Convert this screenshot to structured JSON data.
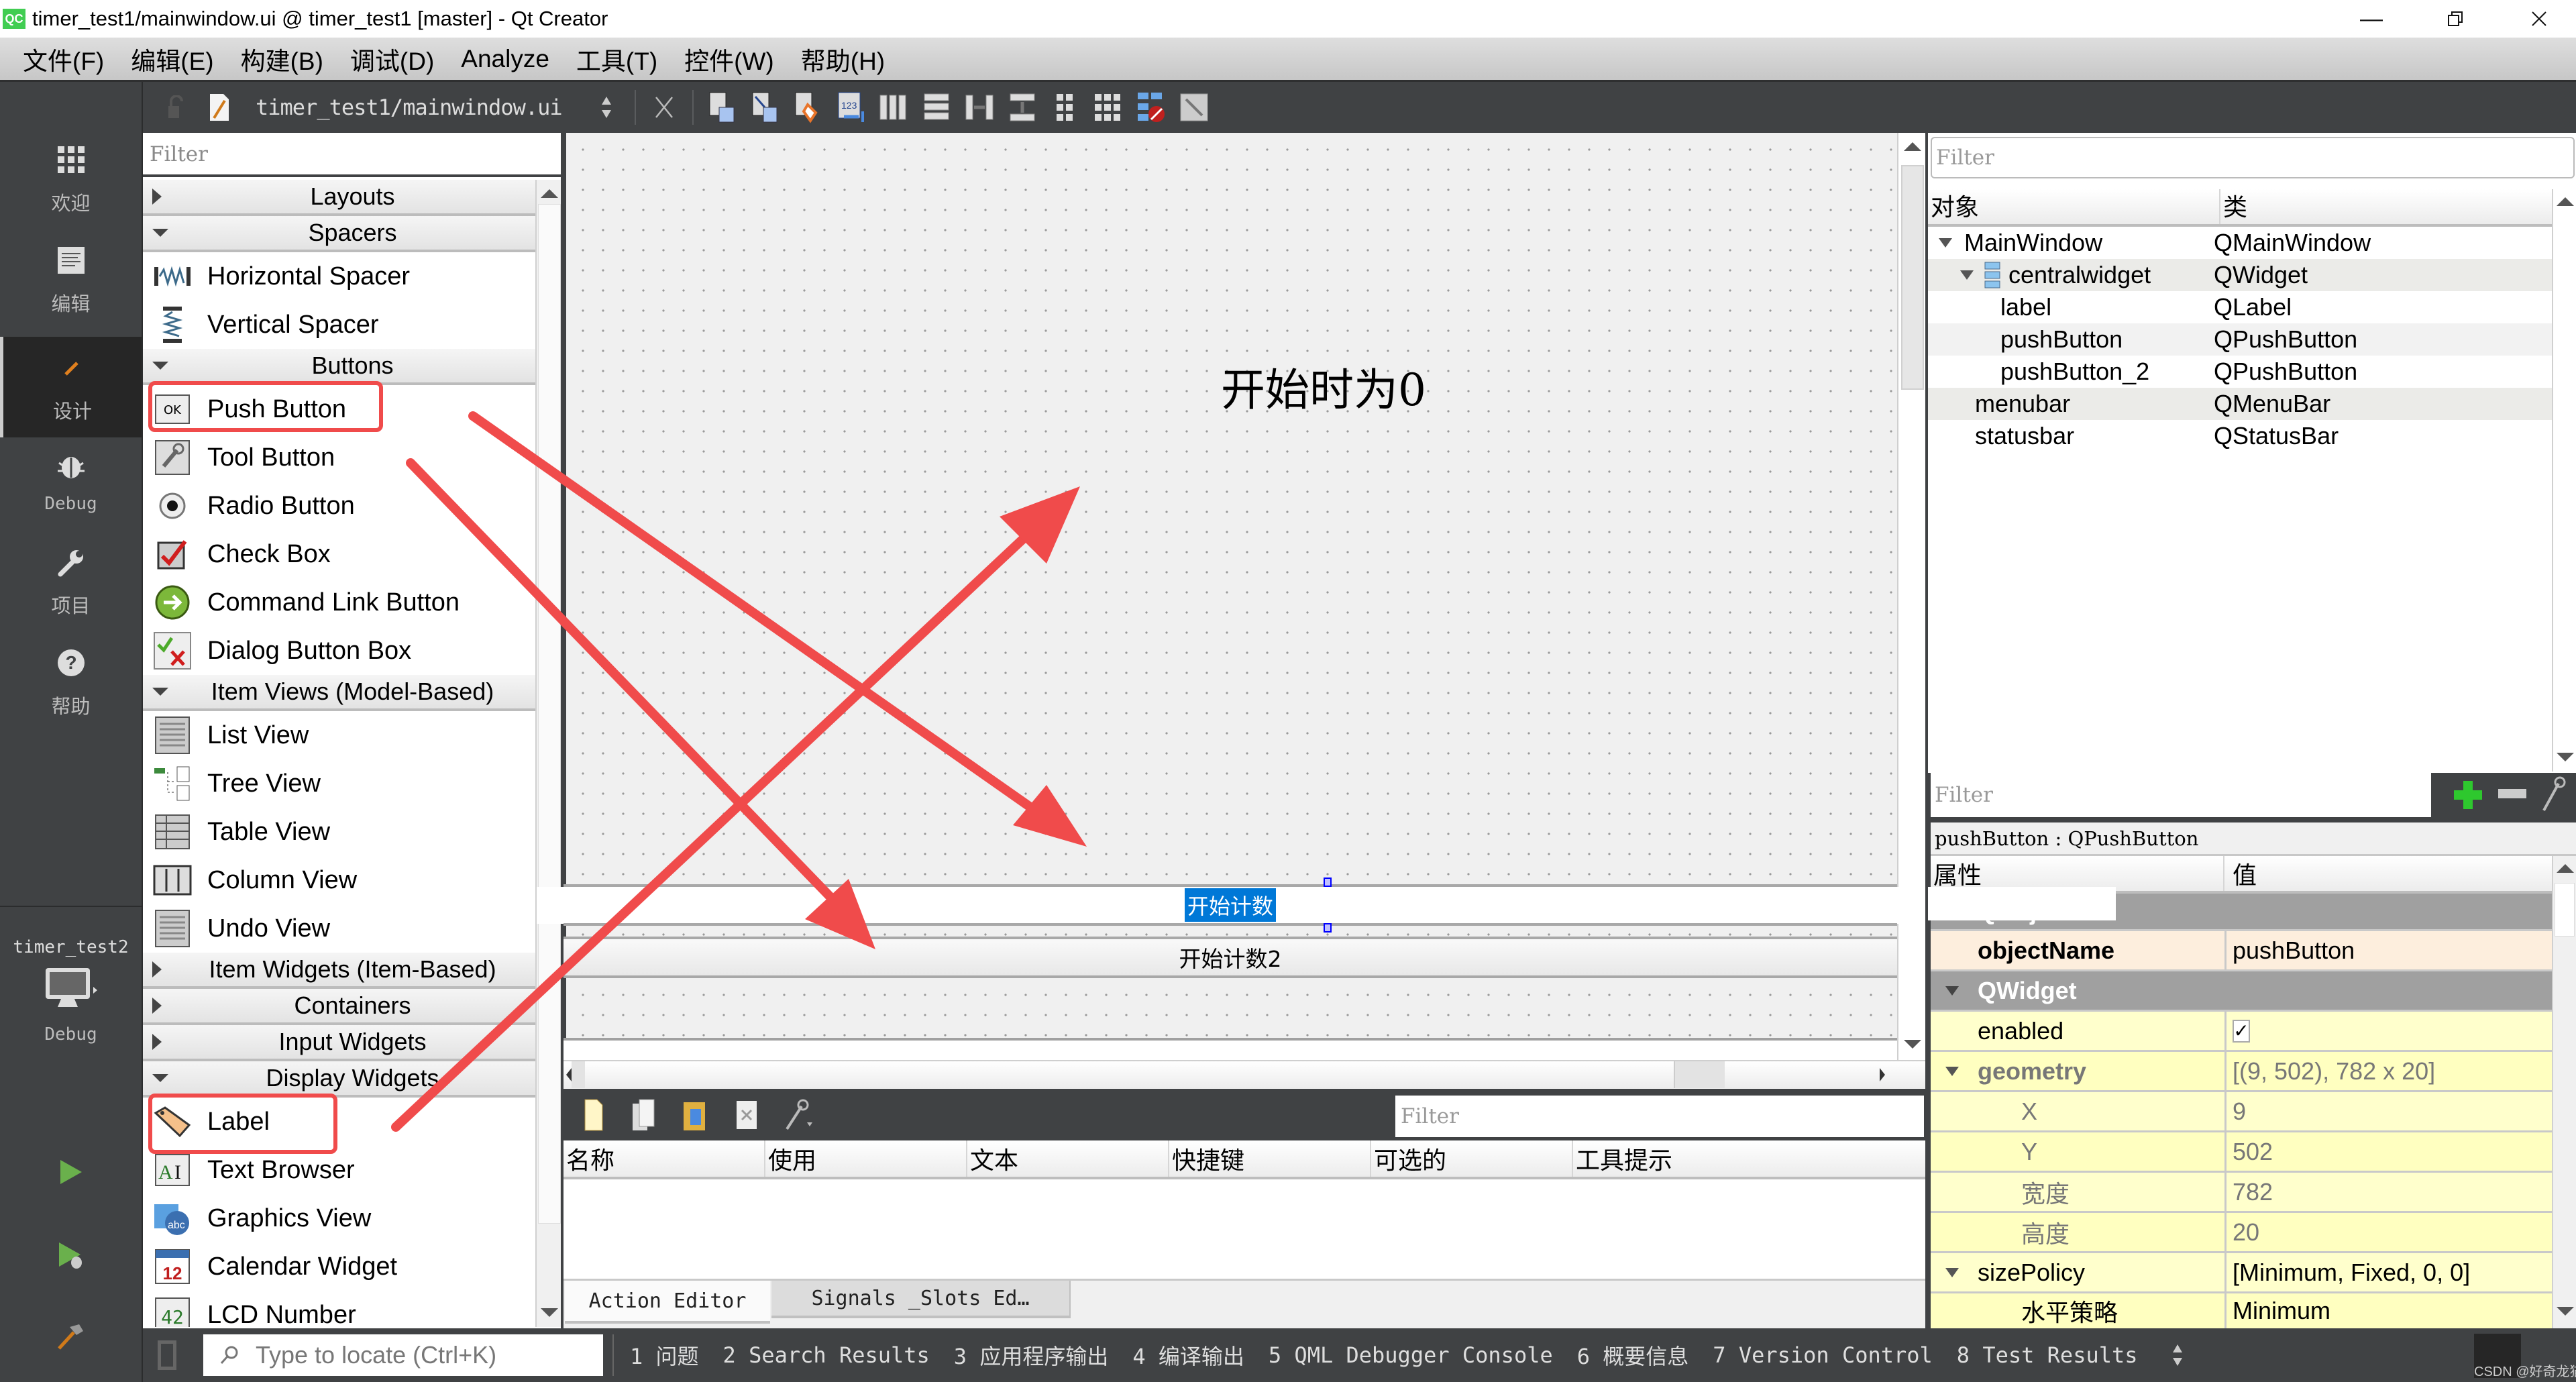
{
  "window": {
    "title": "timer_test1/mainwindow.ui @ timer_test1 [master] - Qt Creator",
    "app_logo": "QC"
  },
  "menubar": {
    "items": [
      "文件(F)",
      "编辑(E)",
      "构建(B)",
      "调试(D)",
      "Analyze",
      "工具(T)",
      "控件(W)",
      "帮助(H)"
    ]
  },
  "toolbar": {
    "document": "timer_test1/mainwindow.ui",
    "icons": [
      "lock-icon",
      "edit-document-icon",
      "document-switcher-icon",
      "close-document-icon",
      "edit-widgets-icon",
      "edit-signals-slots-icon",
      "edit-buddies-icon",
      "edit-tab-order-icon",
      "layout-horizontal-icon",
      "layout-vertical-icon",
      "layout-horizontal-splitter-icon",
      "layout-vertical-splitter-icon",
      "layout-form-icon",
      "layout-grid-icon",
      "break-layout-icon",
      "adjust-size-icon"
    ]
  },
  "modes": {
    "items": [
      {
        "label": "欢迎",
        "icon": "welcome-grid-icon"
      },
      {
        "label": "编辑",
        "icon": "edit-icon"
      },
      {
        "label": "设计",
        "icon": "design-pencil-icon",
        "active": true
      },
      {
        "label": "Debug",
        "icon": "debug-bug-icon"
      },
      {
        "label": "项目",
        "icon": "projects-wrench-icon"
      },
      {
        "label": "帮助",
        "icon": "help-icon"
      }
    ],
    "kit_project": "timer_test2",
    "kit_mode": "Debug"
  },
  "widgetbox": {
    "filter_placeholder": "Filter",
    "categories": [
      {
        "label": "Layouts",
        "expanded": false,
        "items": []
      },
      {
        "label": "Spacers",
        "expanded": true,
        "items": [
          "Horizontal Spacer",
          "Vertical Spacer"
        ]
      },
      {
        "label": "Buttons",
        "expanded": true,
        "items": [
          "Push Button",
          "Tool Button",
          "Radio Button",
          "Check Box",
          "Command Link Button",
          "Dialog Button Box"
        ]
      },
      {
        "label": "Item Views (Model-Based)",
        "expanded": true,
        "items": [
          "List View",
          "Tree View",
          "Table View",
          "Column View",
          "Undo View"
        ]
      },
      {
        "label": "Item Widgets (Item-Based)",
        "expanded": false,
        "items": []
      },
      {
        "label": "Containers",
        "expanded": false,
        "items": []
      },
      {
        "label": "Input Widgets",
        "expanded": false,
        "items": []
      },
      {
        "label": "Display Widgets",
        "expanded": true,
        "items": [
          "Label",
          "Text Browser",
          "Graphics View",
          "Calendar Widget",
          "LCD Number"
        ]
      }
    ]
  },
  "form": {
    "label_text": "开始时为0",
    "push_button_text": "开始计数",
    "push_button_2_text": "开始计数2"
  },
  "action_editor": {
    "filter_placeholder": "Filter",
    "columns": [
      "名称",
      "使用",
      "文本",
      "快捷键",
      "可选的",
      "工具提示"
    ],
    "tabs": [
      "Action Editor",
      "Signals _Slots Ed…"
    ]
  },
  "object_inspector": {
    "filter_placeholder": "Filter",
    "columns": [
      "对象",
      "类"
    ],
    "rows": [
      {
        "object": "MainWindow",
        "class": "QMainWindow",
        "depth": 0,
        "expanded": true
      },
      {
        "object": "centralwidget",
        "class": "QWidget",
        "depth": 1,
        "expanded": true
      },
      {
        "object": "label",
        "class": "QLabel",
        "depth": 2
      },
      {
        "object": "pushButton",
        "class": "QPushButton",
        "depth": 2
      },
      {
        "object": "pushButton_2",
        "class": "QPushButton",
        "depth": 2
      },
      {
        "object": "menubar",
        "class": "QMenuBar",
        "depth": 1
      },
      {
        "object": "statusbar",
        "class": "QStatusBar",
        "depth": 1
      }
    ]
  },
  "property_editor": {
    "filter_placeholder": "Filter",
    "class_label": "pushButton : QPushButton",
    "columns": [
      "属性",
      "值"
    ],
    "rows": [
      {
        "name": "QObject",
        "value": "",
        "type": "group"
      },
      {
        "name": "objectName",
        "value": "pushButton",
        "type": "obj"
      },
      {
        "name": "QWidget",
        "value": "",
        "type": "group"
      },
      {
        "name": "enabled",
        "value": "✓",
        "type": "check"
      },
      {
        "name": "geometry",
        "value": "[(9, 502), 782 x 20]",
        "type": "parent"
      },
      {
        "name": "X",
        "value": "9",
        "type": "child"
      },
      {
        "name": "Y",
        "value": "502",
        "type": "child"
      },
      {
        "name": "宽度",
        "value": "782",
        "type": "child"
      },
      {
        "name": "高度",
        "value": "20",
        "type": "child"
      },
      {
        "name": "sizePolicy",
        "value": "[Minimum, Fixed, 0, 0]",
        "type": "parent"
      },
      {
        "name": "水平策略",
        "value": "Minimum",
        "type": "child"
      }
    ]
  },
  "bottombar": {
    "locator_placeholder": "Type to locate (Ctrl+K)",
    "panes": [
      "1  问题",
      "2  Search Results",
      "3  应用程序输出",
      "4  编译输出",
      "5  QML Debugger Console",
      "6  概要信息",
      "7  Version Control",
      "8  Test Results"
    ],
    "watermark": "CSDN @好奇龙猫"
  },
  "colors": {
    "annotation_red": "#f04b4b",
    "selection_blue": "#0078d7",
    "dark_chrome": "#404244"
  }
}
